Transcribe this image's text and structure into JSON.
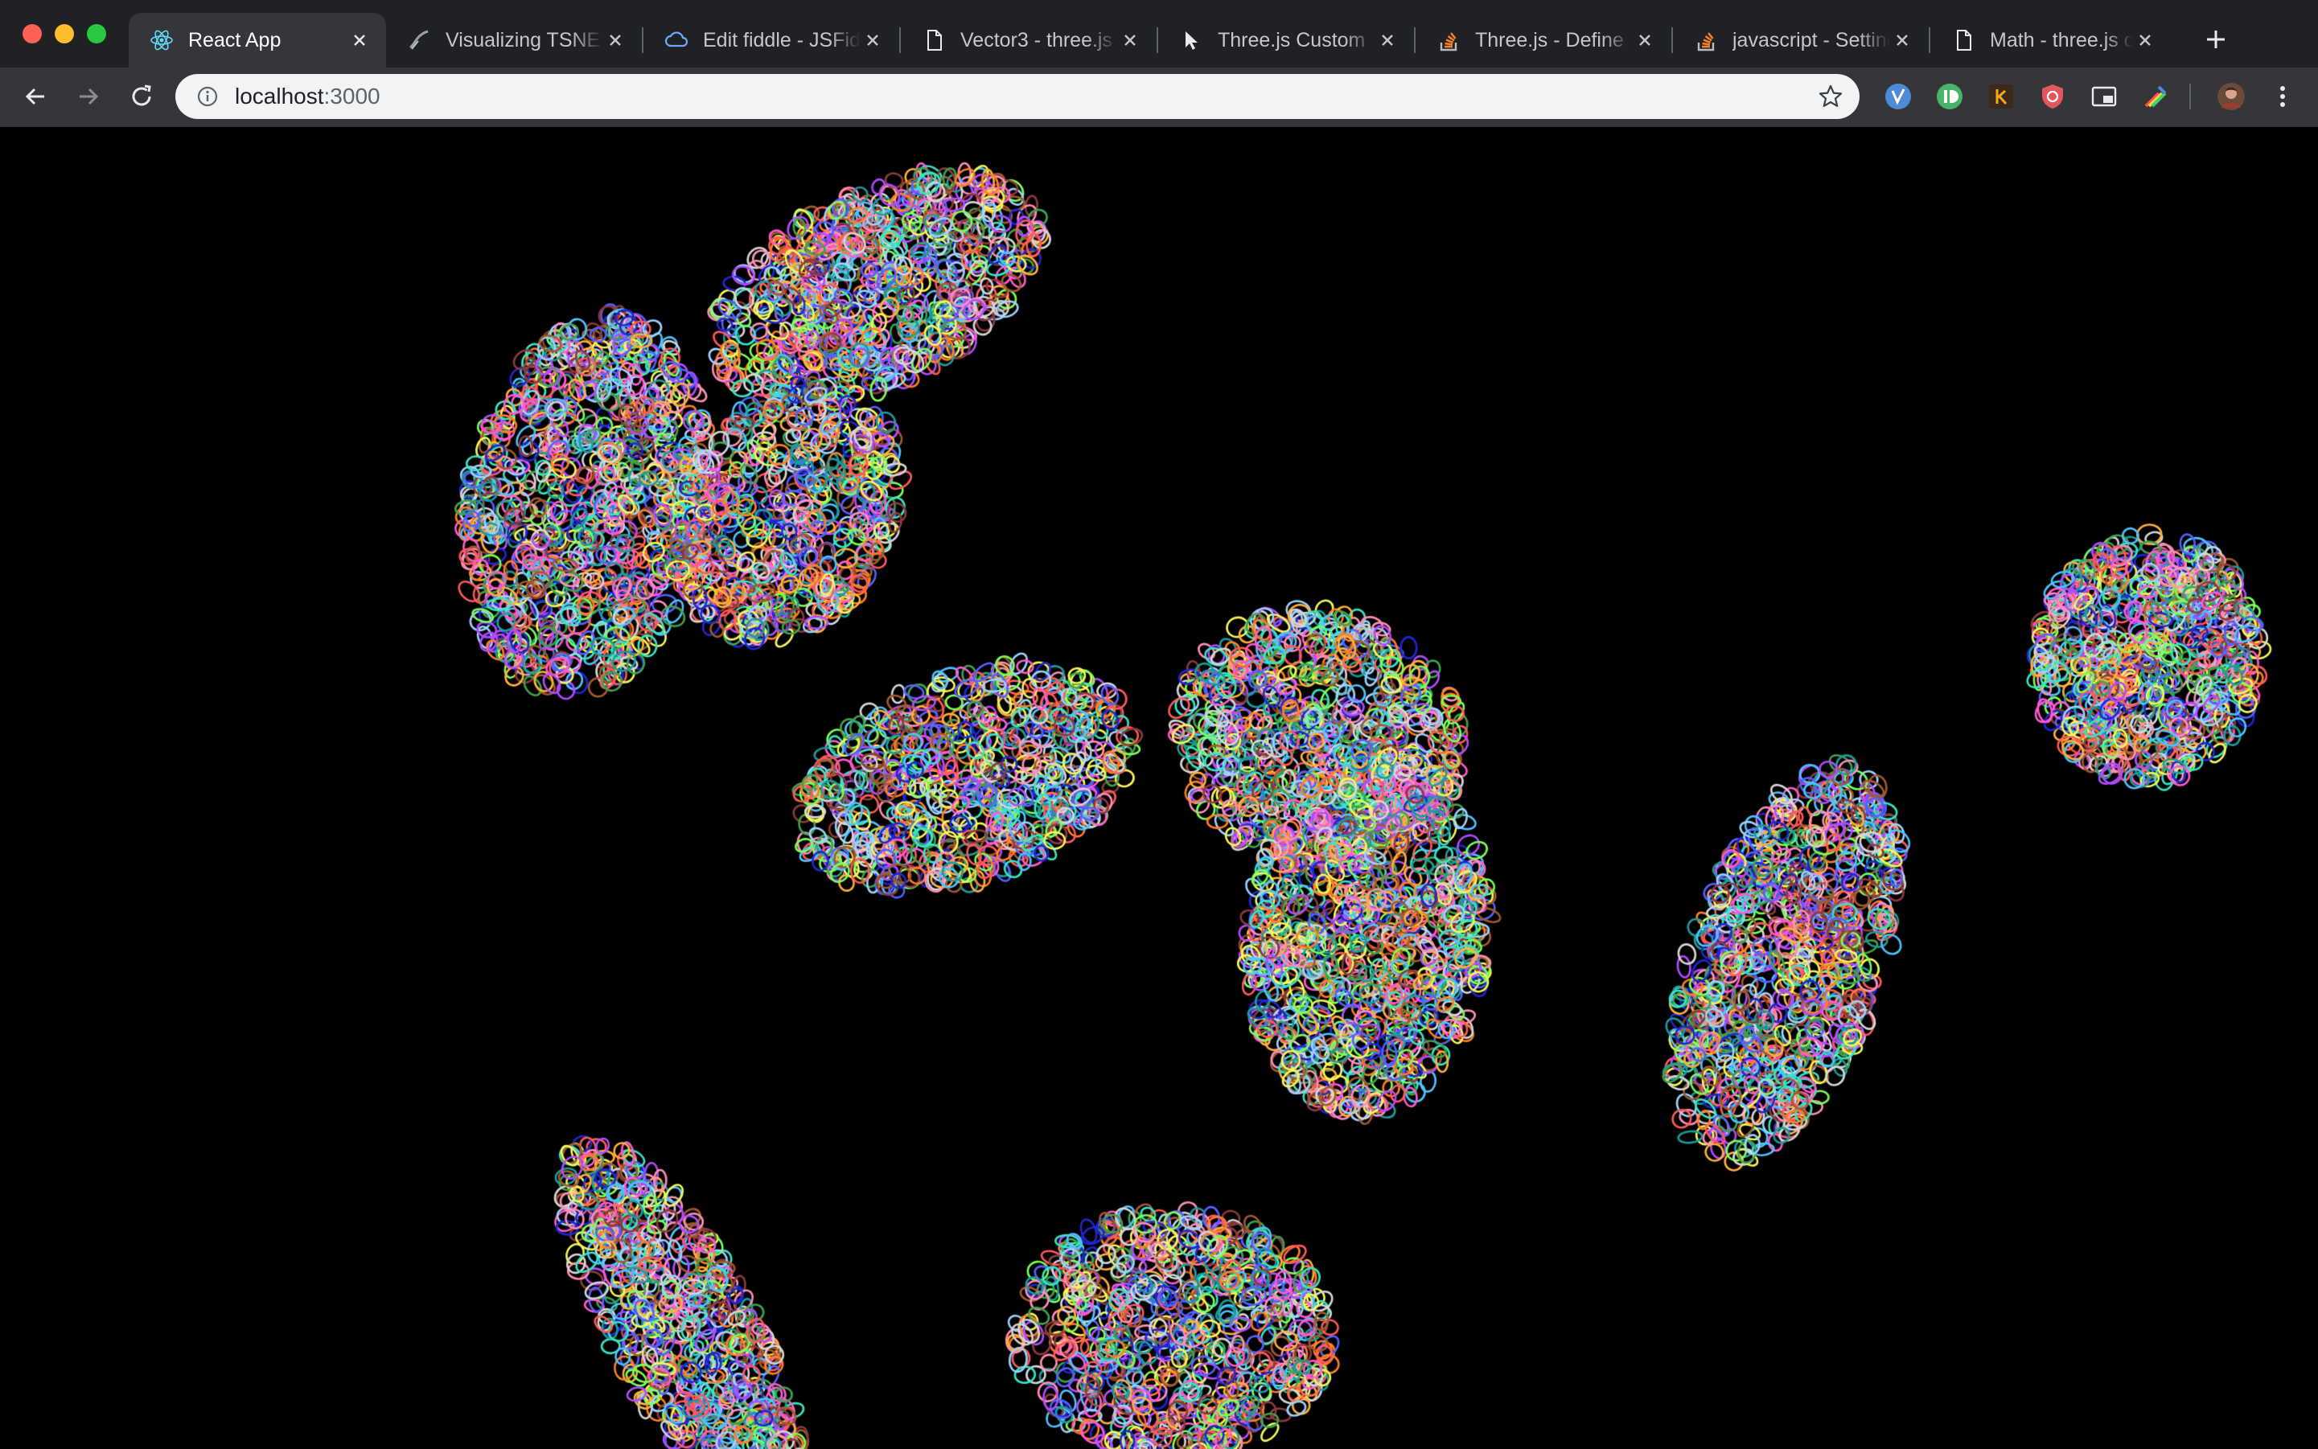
{
  "browser": {
    "tabs": [
      {
        "title": "React App",
        "favicon": "react-icon",
        "active": true
      },
      {
        "title": "Visualizing TSNE",
        "favicon": "graph-icon",
        "active": false
      },
      {
        "title": "Edit fiddle - JSFiddle",
        "favicon": "cloud-icon",
        "active": false
      },
      {
        "title": "Vector3 - three.js",
        "favicon": "page-icon",
        "active": false
      },
      {
        "title": "Three.js Custom",
        "favicon": "cursor-icon",
        "active": false
      },
      {
        "title": "Three.js - Define",
        "favicon": "stackoverflow-icon",
        "active": false
      },
      {
        "title": "javascript - Setting",
        "favicon": "stackoverflow-icon",
        "active": false
      },
      {
        "title": "Math - three.js docs",
        "favicon": "page-icon",
        "active": false
      }
    ],
    "address": {
      "host": "localhost",
      "port": ":3000"
    },
    "extensions": [
      "vimium-icon",
      "pushbullet-icon",
      "keep-icon",
      "shield-icon",
      "picture-in-picture-icon",
      "color-picker-icon"
    ],
    "colors": {
      "tabstrip": "#202124",
      "toolbar": "#35363a",
      "omnibox": "#f1f3f4",
      "canvas": "#000000"
    }
  },
  "canvas": {
    "description_icon": "tsne-scatter-canvas",
    "point_palette": [
      "#ff5a5a",
      "#ffb13b",
      "#f7f759",
      "#7cff5a",
      "#37e6c4",
      "#4fc3ff",
      "#5560ff",
      "#2026d0",
      "#b44bff",
      "#ff5ad2",
      "#ff8fb8",
      "#8b3a3a",
      "#3fa34d",
      "#9dd3ff",
      "#d7d7d7",
      "#ff7f27",
      "#1d9b9b",
      "#a05a2c"
    ]
  }
}
